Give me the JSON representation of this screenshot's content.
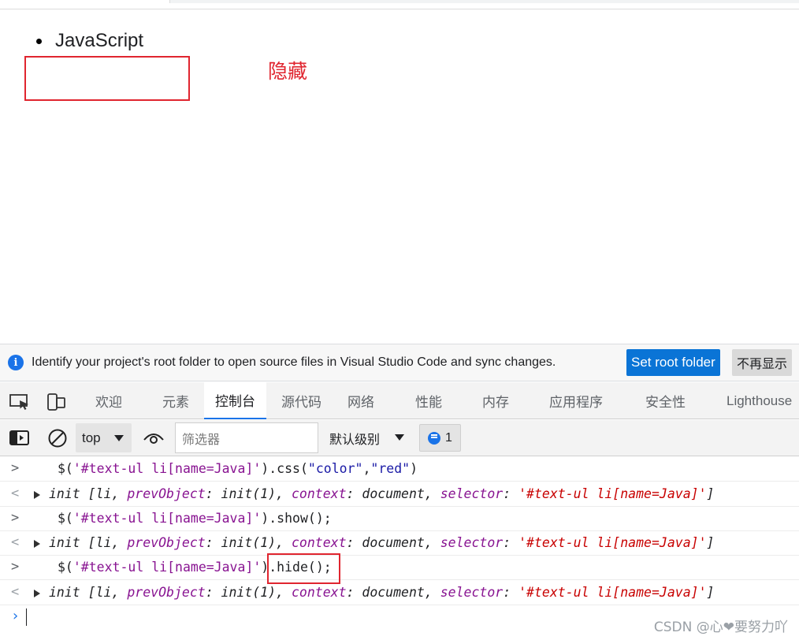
{
  "page": {
    "list_items": [
      "JavaScript"
    ],
    "annotation_label": "隐藏"
  },
  "infobar": {
    "message": "Identify your project's root folder to open source files in Visual Studio Code and sync changes.",
    "primary_button": "Set root folder",
    "secondary_button": "不再显示"
  },
  "devtools": {
    "tabs": [
      "欢迎",
      "元素",
      "控制台",
      "源代码",
      "网络",
      "性能",
      "内存",
      "应用程序",
      "安全性",
      "Lighthouse"
    ],
    "active_tab": "控制台"
  },
  "console_toolbar": {
    "context": "top",
    "filter_placeholder": "筛选器",
    "levels": "默认级别",
    "message_count": "1"
  },
  "console": {
    "entries": [
      {
        "type": "input",
        "prefix": "$(",
        "selector": "'#text-ul li[name=Java]'",
        "suffix_plain": ").css(",
        "arg1": "\"color\"",
        "comma": ",",
        "arg2": "\"red\"",
        "close": ")"
      },
      {
        "type": "output",
        "text_head": "init [li, ",
        "k1": "prevObject",
        "v1": ": init(1), ",
        "k2": "context",
        "v2": ": document, ",
        "k3": "selector",
        "v3sep": ": ",
        "v3": "'#text-ul li[name=Java]'",
        "tail": "]"
      },
      {
        "type": "input",
        "prefix": "$(",
        "selector": "'#text-ul li[name=Java]'",
        "suffix_plain": ").show();"
      },
      {
        "type": "output",
        "text_head": "init [li, ",
        "k1": "prevObject",
        "v1": ": init(1), ",
        "k2": "context",
        "v2": ": document, ",
        "k3": "selector",
        "v3sep": ": ",
        "v3": "'#text-ul li[name=Java]'",
        "tail": "]"
      },
      {
        "type": "input",
        "prefix": "$(",
        "selector": "'#text-ul li[name=Java]'",
        "suffix_plain": ").hide();"
      },
      {
        "type": "output",
        "text_head": "init [li, ",
        "k1": "prevObject",
        "v1": ": init(1), ",
        "k2": "context",
        "v2": ": document, ",
        "k3": "selector",
        "v3sep": ": ",
        "v3": "'#text-ul li[name=Java]'",
        "tail": "]"
      }
    ],
    "prompt_symbol": "›"
  },
  "watermark": "CSDN @心❤要努力吖",
  "colors": {
    "annotation_red": "#e0252f",
    "accent_blue": "#1a73e8",
    "primary_button": "#0a74d6"
  }
}
